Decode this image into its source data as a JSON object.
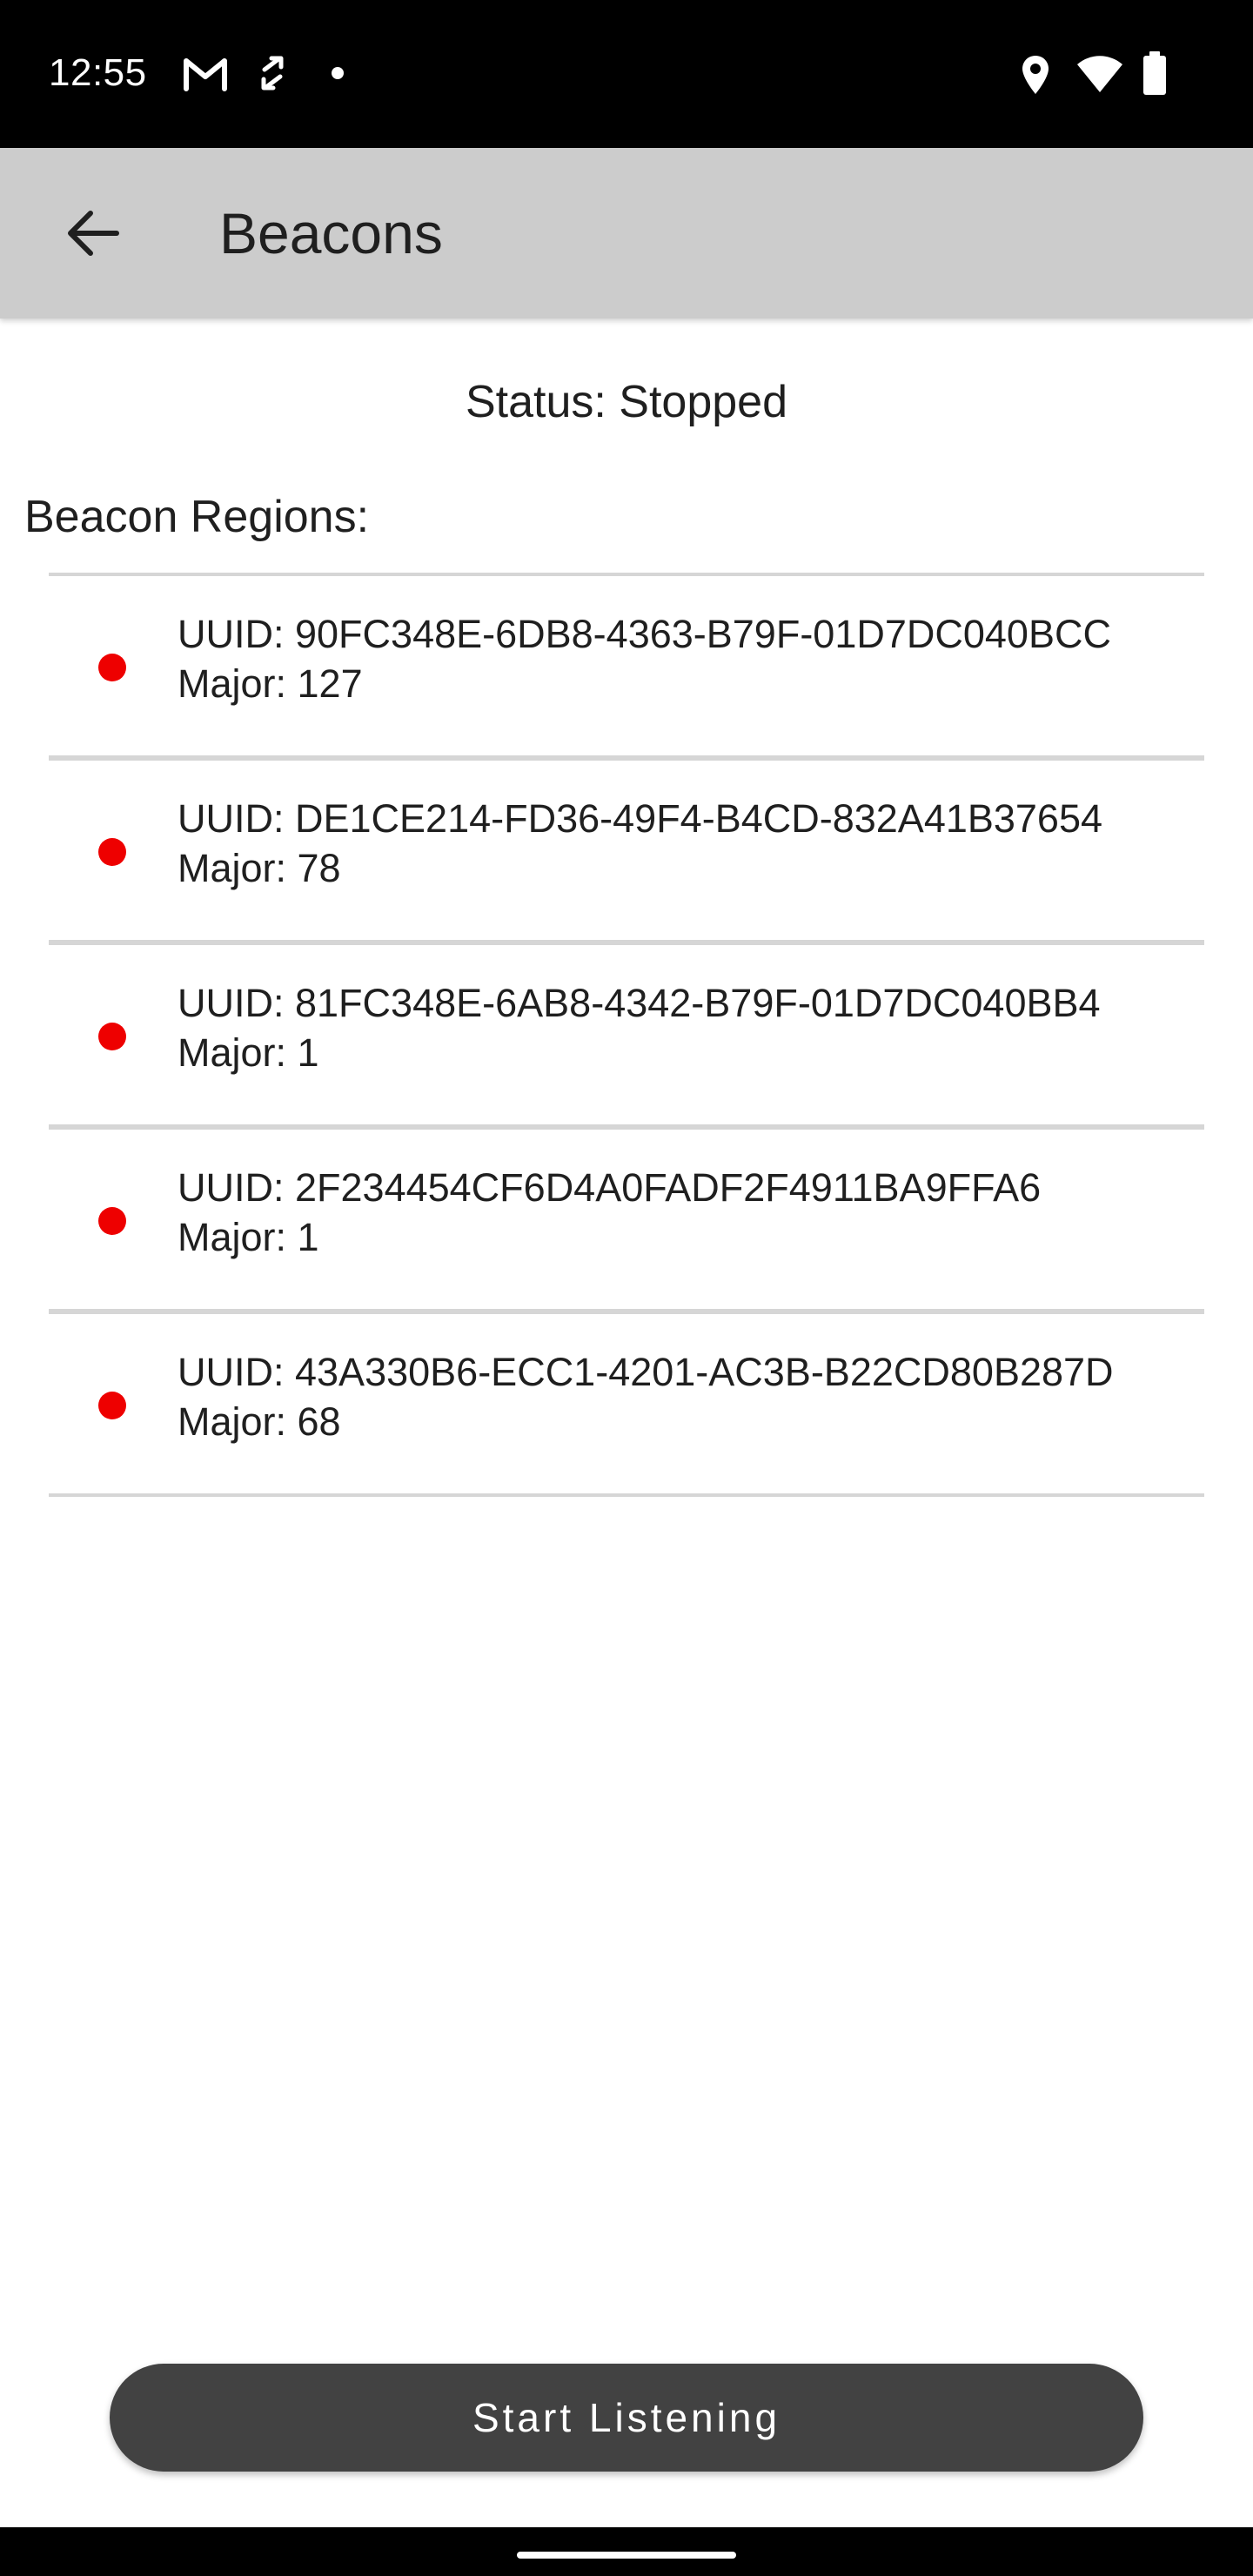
{
  "status_bar": {
    "time": "12:55",
    "icons": [
      "gmail-icon",
      "sync-arrows-icon",
      "notification-dot-icon",
      "location-pin-icon",
      "wifi-icon",
      "battery-icon"
    ]
  },
  "app_bar": {
    "back_icon": "arrow-back-icon",
    "title": "Beacons"
  },
  "status": {
    "text": "Status: Stopped"
  },
  "regions": {
    "label": "Beacon Regions:",
    "indicator_color": "#ee0000",
    "items": [
      {
        "uuid": "UUID: 90FC348E-6DB8-4363-B79F-01D7DC040BCC",
        "major": "Major: 127"
      },
      {
        "uuid": "UUID: DE1CE214-FD36-49F4-B4CD-832A41B37654",
        "major": "Major: 78"
      },
      {
        "uuid": "UUID: 81FC348E-6AB8-4342-B79F-01D7DC040BB4",
        "major": "Major: 1"
      },
      {
        "uuid": "UUID: 2F234454CF6D4A0FADF2F4911BA9FFA6",
        "major": "Major: 1"
      },
      {
        "uuid": "UUID: 43A330B6-ECC1-4201-AC3B-B22CD80B287D",
        "major": "Major: 68"
      }
    ]
  },
  "actions": {
    "start_label": "Start Listening"
  },
  "colors": {
    "app_bar": "#cccccc",
    "button": "#424242",
    "divider": "#d6d6d6"
  }
}
